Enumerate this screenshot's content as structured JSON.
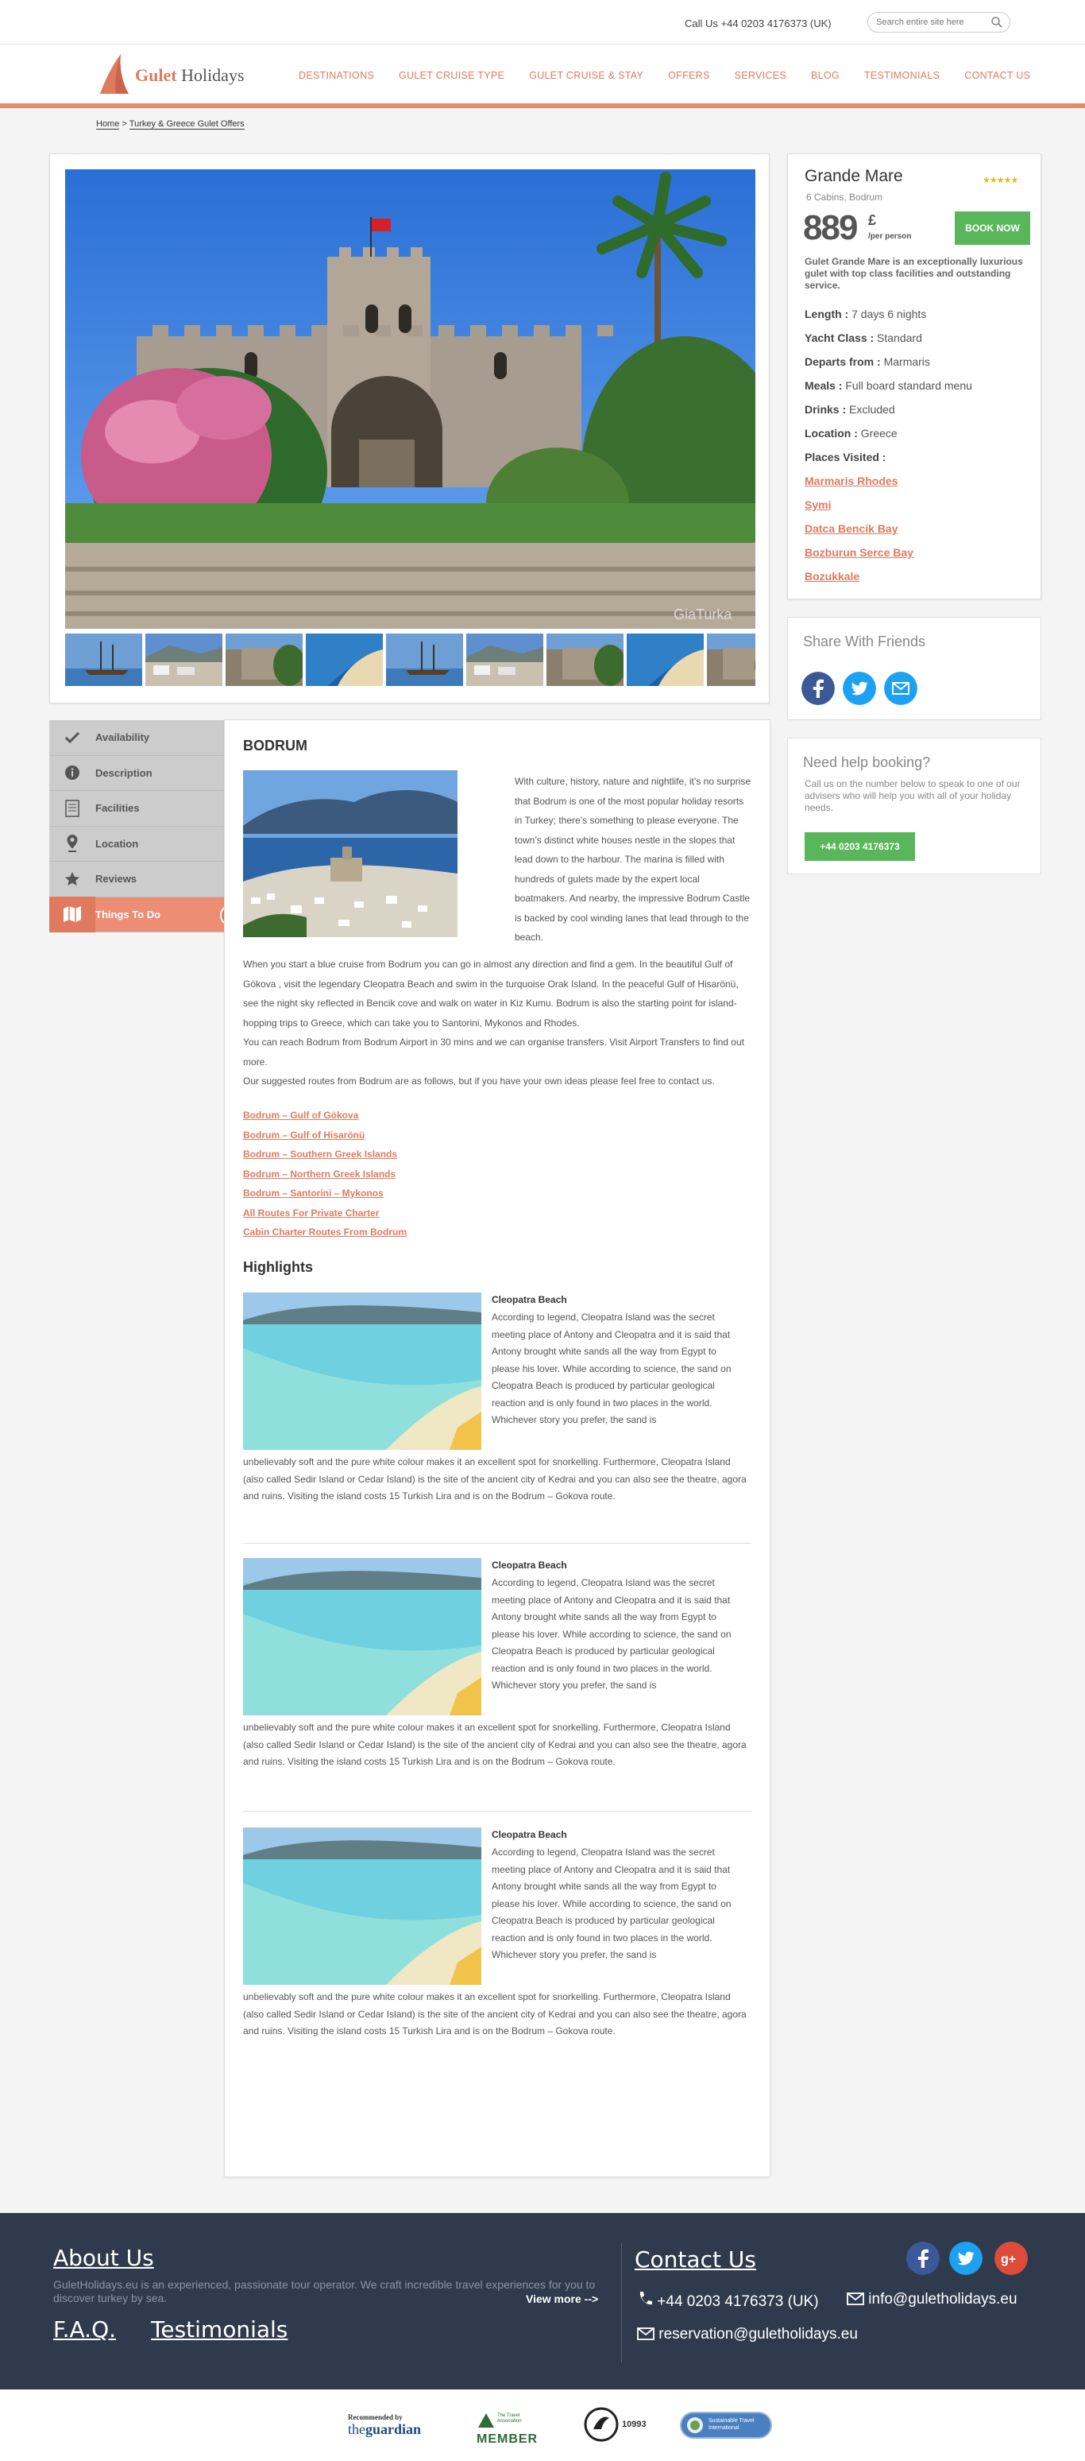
{
  "topbar": {
    "call": "Call Us +44 0203 4176373 (UK)",
    "search_placeholder": "Search entire site here"
  },
  "logo": {
    "brand1": "Gulet",
    "brand2": " Holidays"
  },
  "nav": [
    "DESTINATIONS",
    "GULET CRUISE TYPE",
    "GULET CRUISE & STAY",
    "OFFERS",
    "SERVICES",
    "BLOG",
    "TESTIMONIALS",
    "CONTACT US"
  ],
  "breadcrumb": {
    "home": "Home",
    "separator": ">",
    "current": "Turkey & Greece Gulet Offers"
  },
  "gallery": {
    "watermark": "GiaTurka"
  },
  "booking": {
    "name": "Grande Mare",
    "stars": "★★★★★",
    "cabins": "6 Cabins, Bodrum",
    "price": "889",
    "currency": "£",
    "per_person": "/per person",
    "book_now": "BOOK NOW",
    "description": "Gulet Grande Mare is an exceptionally luxurious gulet with top class facilities and outstanding service.",
    "specs": [
      {
        "label": "Length :",
        "value": " 7 days 6 nights"
      },
      {
        "label": "Yacht Class :",
        "value": " Standard"
      },
      {
        "label": "Departs from :",
        "value": " Marmaris"
      },
      {
        "label": "Meals :",
        "value": " Full board standard menu"
      },
      {
        "label": "Drinks :",
        "value": " Excluded"
      },
      {
        "label": "Location :",
        "value": " Greece"
      },
      {
        "label": "Places Visited :",
        "value": ""
      }
    ],
    "places": [
      "Marmaris Rhodes",
      "Symi",
      "Datca Bencik Bay",
      "Bozburun Serce Bay",
      "Bozukkale"
    ]
  },
  "share": {
    "title": "Share With Friends"
  },
  "help": {
    "title": "Need help booking?",
    "text": "Call us on the number below to speak to one of our advisers who will help you with all of your holiday needs.",
    "phone": "+44 0203 4176373"
  },
  "tabs": [
    "Availability",
    "Description",
    "Facilities",
    "Location",
    "Reviews",
    "Things To Do"
  ],
  "content": {
    "title": "BODRUM",
    "intro": "With culture, history, nature and nightlife, it’s no surprise that Bodrum is one of the most popular holiday resorts in Turkey; there’s something to please everyone. The town’s distinct white houses nestle in the slopes that lead down to the harbour. The marina is filled with hundreds of gulets made by the expert local boatmakers. And nearby, the impressive Bodrum Castle is backed by cool winding lanes that lead through to the beach.",
    "para1": "When you start a blue cruise from Bodrum you can go in almost any direction and find a gem. In the beautiful Gulf of Gökova , visit the legendary Cleopatra Beach and swim in the turquoise Orak Island. In the peaceful Gulf of Hisarönü, see the night sky reflected in Bencik cove and walk on water in Kiz Kumu. Bodrum is also the starting point for island-hopping trips to Greece, which can take you to Santorini, Mykonos and Rhodes.",
    "para2": "You can reach Bodrum from Bodrum Airport in 30 mins and we can organise transfers.  Visit Airport Transfers to find out more.",
    "para3": "Our suggested routes from Bodrum are as follows, but if you have your own ideas please feel free to contact us.",
    "routes": [
      "Bodrum – Gulf of Gökova",
      "Bodrum – Gulf of Hisarönü",
      "Bodrum – Southern Greek Islands",
      "Bodrum – Northern Greek Islands",
      "Bodrum – Santorini – Mykonos",
      "All Routes For Private Charter",
      "Cabin Charter Routes From Bodrum"
    ],
    "highlights_title": "Highlights",
    "highlights": [
      {
        "title": "Cleopatra Beach",
        "text": "According to legend, Cleopatra Island was the secret meeting place of Antony and Cleopatra and it is said that Antony brought white sands all the way from Egypt to please his lover. While according to science, the sand on Cleopatra Beach is produced by particular geological reaction and is only found in two places in the world. Whichever story you prefer, the sand is",
        "more": "unbelievably soft and the pure white colour makes it an excellent spot for snorkelling. Furthermore, Cleopatra Island (also called Sedir Island or Cedar Island) is the site of the ancient city of Kedrai and you can also see the theatre, agora and ruins. Visiting the island costs 15 Turkish Lira and is on the Bodrum – Gokova route."
      },
      {
        "title": "Cleopatra Beach",
        "text": "According to legend, Cleopatra Island was the secret meeting place of Antony and Cleopatra and it is said that Antony brought white sands all the way from Egypt to please his lover. While according to science, the sand on Cleopatra Beach is produced by particular geological reaction and is only found in two places in the world. Whichever story you prefer, the sand is",
        "more": "unbelievably soft and the pure white colour makes it an excellent spot for snorkelling. Furthermore, Cleopatra Island (also called Sedir Island or Cedar Island) is the site of the ancient city of Kedrai and you can also see the theatre, agora and ruins. Visiting the island costs 15 Turkish Lira and is on the Bodrum – Gokova route."
      },
      {
        "title": "Cleopatra Beach",
        "text": "According to legend, Cleopatra Island was the secret meeting place of Antony and Cleopatra and it is said that Antony brought white sands all the way from Egypt to please his lover. While according to science, the sand on Cleopatra Beach is produced by particular geological reaction and is only found in two places in the world. Whichever story you prefer, the sand is",
        "more": "unbelievably soft and the pure white colour makes it an excellent spot for snorkelling. Furthermore, Cleopatra Island (also called Sedir Island or Cedar Island) is the site of the ancient city of Kedrai and you can also see the theatre, agora and ruins. Visiting the island costs 15 Turkish Lira and is on the Bodrum – Gokova route."
      }
    ]
  },
  "footer": {
    "about_title": "About Us",
    "about_text": "GuletHolidays.eu is an experienced, passionate tour operator. We craft incredible travel experiences for you to discover turkey by sea.",
    "view_more": "View more -->",
    "faq": "F.A.Q.",
    "testimonials": "Testimonials",
    "contact_title": "Contact Us",
    "phone": "+44 0203 4176373 (UK)",
    "email": "info@guletholidays.eu",
    "email2": "reservation@guletholidays.eu"
  },
  "partners": {
    "guardian_top": "Recommended by",
    "guardian_the": "the",
    "guardian_name": "guardian",
    "member_top": "The Travel Association",
    "member": "MEMBER",
    "abta_num": "10993",
    "sustain": "Sustainable Travel International"
  },
  "colors": {
    "accent": "#e07a5f",
    "green": "#5ab65a",
    "footer": "#2f3b4d",
    "facebook": "#3b5998",
    "twitter": "#1da1f2",
    "google": "#dd4b39"
  }
}
